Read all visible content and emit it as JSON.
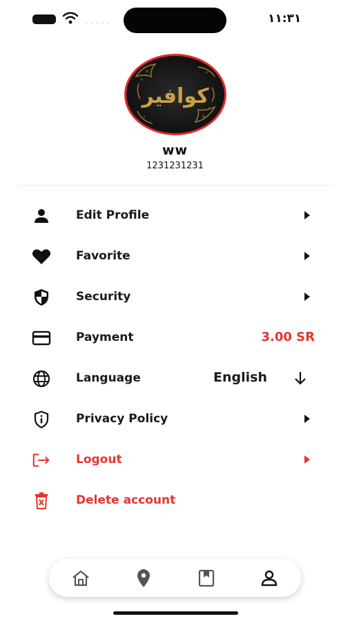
{
  "status_bar": {
    "time": "١١:٣١",
    "signal_dots": "....."
  },
  "profile": {
    "avatar_logo_text": "كوافير",
    "name": "ww",
    "phone": "1231231231"
  },
  "menu": {
    "edit_profile": {
      "label": "Edit Profile",
      "icon": "person-icon"
    },
    "favorite": {
      "label": "Favorite",
      "icon": "heart-icon"
    },
    "security": {
      "label": "Security",
      "icon": "shield-icon"
    },
    "payment": {
      "label": "Payment",
      "icon": "card-icon",
      "value": "3.00 SR"
    },
    "language": {
      "label": "Language",
      "icon": "globe-icon",
      "value": "English"
    },
    "privacy": {
      "label": "Privacy Policy",
      "icon": "info-shield-icon"
    },
    "logout": {
      "label": "Logout",
      "icon": "logout-icon"
    },
    "delete": {
      "label": "Delete account",
      "icon": "trash-icon"
    }
  },
  "bottom_nav": {
    "items": [
      "home-icon",
      "location-pin-icon",
      "bookmark-icon",
      "profile-icon"
    ],
    "active": "profile-icon"
  },
  "colors": {
    "accent_red": "#e8332f",
    "text_dark": "#1a1a1a",
    "avatar_border": "#e02b2b",
    "logo_gold": "#c9a14a"
  }
}
